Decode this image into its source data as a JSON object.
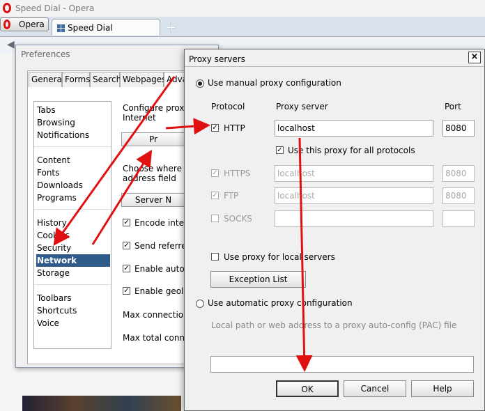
{
  "window": {
    "title": "Speed Dial - Opera"
  },
  "browser": {
    "menu_label": "Opera",
    "tab_label": "Speed Dial",
    "new_tab": "+"
  },
  "prefs": {
    "title": "Preferences",
    "tabs": [
      "General",
      "Forms",
      "Search",
      "Webpages",
      "Adva"
    ],
    "categories": [
      "Tabs",
      "Browsing",
      "Notifications",
      "Content",
      "Fonts",
      "Downloads",
      "Programs",
      "History",
      "Cookies",
      "Security",
      "Network",
      "Storage",
      "Toolbars",
      "Shortcuts",
      "Voice"
    ],
    "selected_category": "Network",
    "configure_text_1": "Configure proxy",
    "configure_text_2": "Internet",
    "proxy_button": "Pr",
    "choose_text_1": "Choose where O",
    "choose_text_2": "address field",
    "server_button": "Server N",
    "options": [
      {
        "label": "Encode intern",
        "checked": true
      },
      {
        "label": "Send referrer",
        "checked": true
      },
      {
        "label": "Enable autom",
        "checked": true
      },
      {
        "label": "Enable geoloc",
        "checked": true
      }
    ],
    "max_connections": "Max connections",
    "max_total": "Max total conne"
  },
  "proxy": {
    "title": "Proxy servers",
    "close": "×",
    "manual_label": "Use manual proxy configuration",
    "col_protocol": "Protocol",
    "col_server": "Proxy server",
    "col_port": "Port",
    "rows": [
      {
        "protocol": "HTTP",
        "server": "localhost",
        "port": "8080",
        "checked": true,
        "enabled": true
      },
      {
        "protocol": "HTTPS",
        "server": "localhost",
        "port": "8080",
        "checked": true,
        "enabled": false
      },
      {
        "protocol": "FTP",
        "server": "localhost",
        "port": "8080",
        "checked": true,
        "enabled": false
      },
      {
        "protocol": "SOCKS",
        "server": "",
        "port": "",
        "checked": false,
        "enabled": false
      }
    ],
    "use_all_label": "Use this proxy for all protocols",
    "use_all_checked": true,
    "local_label": "Use proxy for local servers",
    "local_checked": false,
    "exception_button": "Exception List",
    "auto_label": "Use automatic proxy configuration",
    "pac_hint": "Local path or web address to a proxy auto-config (PAC) file",
    "pac_value": "",
    "ok": "OK",
    "cancel": "Cancel",
    "help": "Help"
  },
  "annotation_color": "#e01010"
}
